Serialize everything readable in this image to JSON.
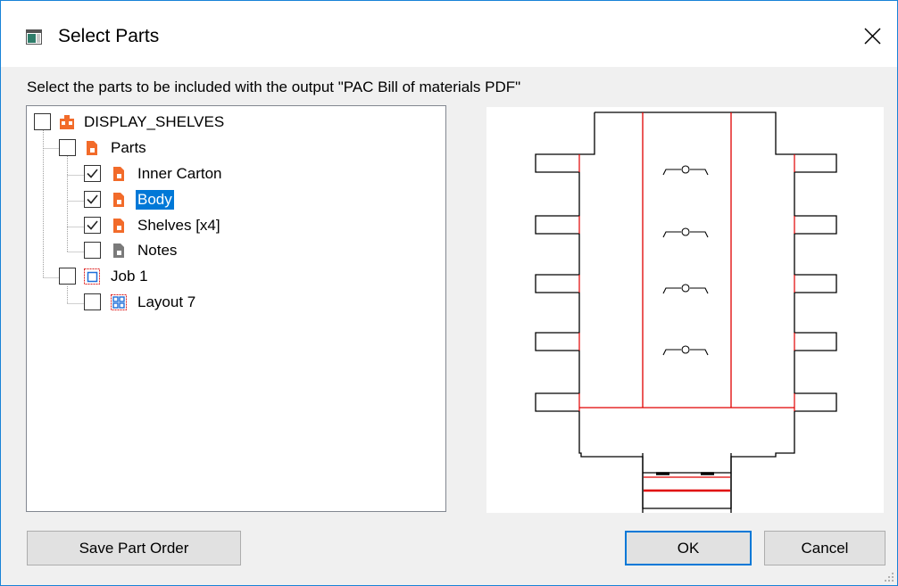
{
  "window": {
    "title": "Select Parts",
    "close_icon": "close-icon"
  },
  "instruction": "Select the parts to be included with the output \"PAC Bill of materials PDF\"",
  "tree": [
    {
      "id": "display-shelves",
      "label": "DISPLAY_SHELVES",
      "checked": false,
      "icon": "design-icon"
    },
    {
      "id": "parts",
      "label": "Parts",
      "checked": false,
      "icon": "part-icon"
    },
    {
      "id": "inner-carton",
      "label": "Inner Carton",
      "checked": true,
      "icon": "part-icon"
    },
    {
      "id": "body",
      "label": "Body",
      "checked": true,
      "icon": "part-icon",
      "selected": true
    },
    {
      "id": "shelves",
      "label": "Shelves [x4]",
      "checked": true,
      "icon": "part-icon"
    },
    {
      "id": "notes",
      "label": "Notes",
      "checked": false,
      "icon": "notes-icon"
    },
    {
      "id": "job-1",
      "label": "Job 1",
      "checked": false,
      "icon": "job-icon"
    },
    {
      "id": "layout-7",
      "label": "Layout 7",
      "checked": false,
      "icon": "layout-icon"
    }
  ],
  "buttons": {
    "save_part_order": "Save Part Order",
    "ok": "OK",
    "cancel": "Cancel"
  },
  "colors": {
    "accent": "#0078d7",
    "part_orange": "#f26b2a",
    "cut_line": "#000000",
    "crease_line": "#e00000"
  }
}
